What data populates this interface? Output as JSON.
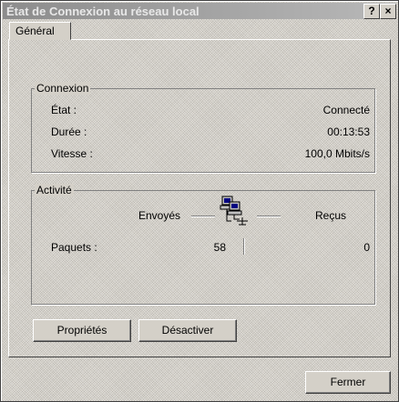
{
  "window": {
    "title": "État de Connexion au réseau local",
    "help_label": "?",
    "close_label": "×"
  },
  "tabs": [
    {
      "label": "Général"
    }
  ],
  "connection": {
    "legend": "Connexion",
    "rows": [
      {
        "label": "État :",
        "value": "Connecté"
      },
      {
        "label": "Durée :",
        "value": "00:13:53"
      },
      {
        "label": "Vitesse :",
        "value": "100,0 Mbits/s"
      }
    ]
  },
  "activity": {
    "legend": "Activité",
    "sent_label": "Envoyés",
    "received_label": "Reçus",
    "packets_label": "Paquets :",
    "packets_sent": "58",
    "packets_received": "0"
  },
  "buttons": {
    "properties": "Propriétés",
    "disable": "Désactiver",
    "close": "Fermer"
  }
}
